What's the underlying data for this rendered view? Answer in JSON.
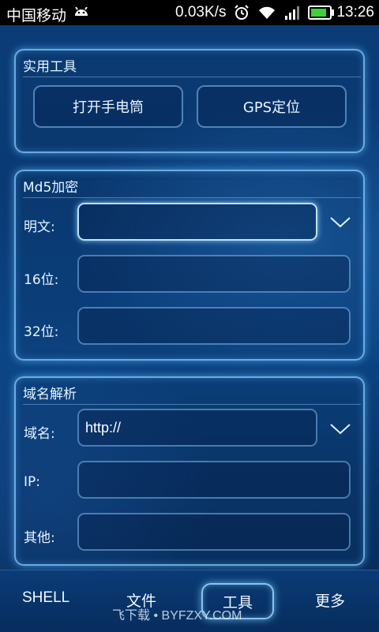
{
  "status_bar": {
    "carrier": "中国移动",
    "speed": "0.03K/s",
    "time": "13:26",
    "icons": [
      "android-icon",
      "alarm-icon",
      "wifi-icon",
      "signal-icon",
      "battery-icon"
    ],
    "battery_level_percent": 85
  },
  "tools_panel": {
    "title": "实用工具",
    "flashlight_label": "打开手电筒",
    "gps_label": "GPS定位"
  },
  "md5_panel": {
    "title": "Md5加密",
    "plain_label": "明文:",
    "plain_value": "",
    "bit16_label": "16位:",
    "bit16_value": "",
    "bit32_label": "32位:",
    "bit32_value": ""
  },
  "dns_panel": {
    "title": "域名解析",
    "domain_label": "域名:",
    "domain_value": "http://",
    "ip_label": "IP:",
    "ip_value": "",
    "other_label": "其他:",
    "other_value": ""
  },
  "bottom_nav": {
    "items": [
      "SHELL",
      "文件",
      "工具",
      "更多"
    ],
    "active": "工具"
  },
  "watermark": "飞下载 • BYFZXY.COM",
  "colors": {
    "accent_glow": "#8cd2ff",
    "background": "#0b3d78",
    "battery_fill": "#3fd13a"
  }
}
